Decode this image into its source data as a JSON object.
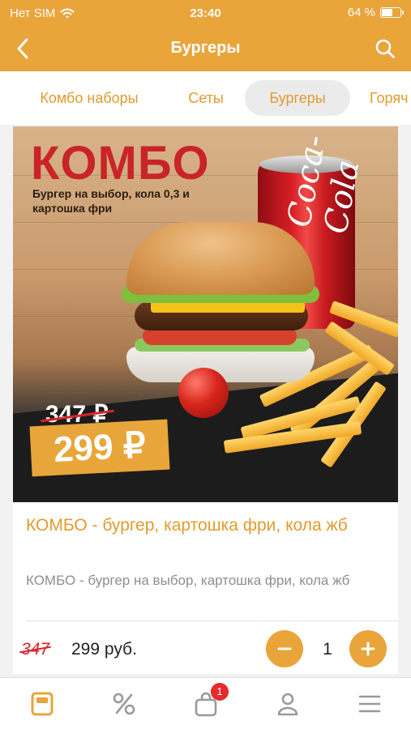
{
  "status_bar": {
    "carrier": "Нет SIM",
    "time": "23:40",
    "battery": "64 %",
    "battery_level": 0.64
  },
  "nav": {
    "title": "Бургеры",
    "back_icon": "chevron-left-icon",
    "search_icon": "search-icon"
  },
  "tabs": [
    {
      "label": "Комбо наборы",
      "active": false
    },
    {
      "label": "Сеты",
      "active": false
    },
    {
      "label": "Бургеры",
      "active": true
    },
    {
      "label": "Горяч",
      "active": false
    }
  ],
  "product": {
    "banner": {
      "title": "КОМБО",
      "subtitle": "Бургер на выбор, кола 0,3 и картошка фри",
      "old_price": "347 ₽",
      "price": "299 ₽",
      "can_text": "Coca-Cola"
    },
    "title": "КОМБО - бургер, картошка фри, кола жб",
    "description": "КОМБО - бургер на выбор, картошка фри, кола жб",
    "old_price": "347",
    "price": "299 руб.",
    "quantity": "1"
  },
  "bottom_nav": {
    "items": [
      "menu-icon",
      "percent-icon",
      "cart-icon",
      "profile-icon",
      "hamburger-icon"
    ],
    "cart_badge": "1"
  },
  "colors": {
    "accent": "#e9a43a",
    "accent_text": "#e39a2e",
    "badge": "#e52b2b",
    "strike": "#d8242a"
  }
}
